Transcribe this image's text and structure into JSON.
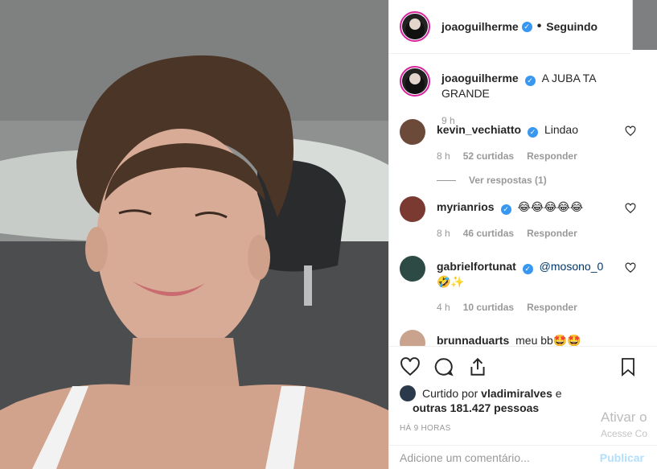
{
  "post": {
    "author": "joaoguilherme",
    "follow_status": "Seguindo",
    "caption": "A JUBA TA GRANDE",
    "caption_age": "9 h"
  },
  "comments": [
    {
      "user": "kevin_vechiatto",
      "verified": true,
      "text": "Lindao",
      "age": "8 h",
      "likes": "52 curtidas",
      "reply": "Responder",
      "view_replies": "Ver respostas (1)"
    },
    {
      "user": "myrianrios",
      "verified": true,
      "text": "😂😂😂😂😂",
      "age": "8 h",
      "likes": "46 curtidas",
      "reply": "Responder"
    },
    {
      "user": "gabrielfortunat",
      "verified": true,
      "text": "@mosono_0",
      "text2": "🤣✨",
      "age": "4 h",
      "likes": "10 curtidas",
      "reply": "Responder"
    },
    {
      "user": "brunnaduarts",
      "verified": false,
      "text": "meu bb🤩🤩"
    }
  ],
  "actions": {
    "liked_prefix": "Curtido por",
    "liked_user": "vladimiralves",
    "liked_suffix": "e",
    "liked_others": "outras 181.427 pessoas",
    "time_ago": "HÁ 9 HORAS"
  },
  "add_comment": {
    "placeholder": "Adicione um comentário...",
    "publish": "Publicar"
  },
  "watermark": {
    "line1": "Ativar o",
    "line2": "Acesse Co"
  },
  "icons": [
    "heart-icon",
    "comment-icon",
    "share-icon",
    "bookmark-icon",
    "verified-icon"
  ],
  "colors": {
    "verified": "#3897f0",
    "publish_disabled": "#b2dffc",
    "story_ring": "#d6249f"
  }
}
